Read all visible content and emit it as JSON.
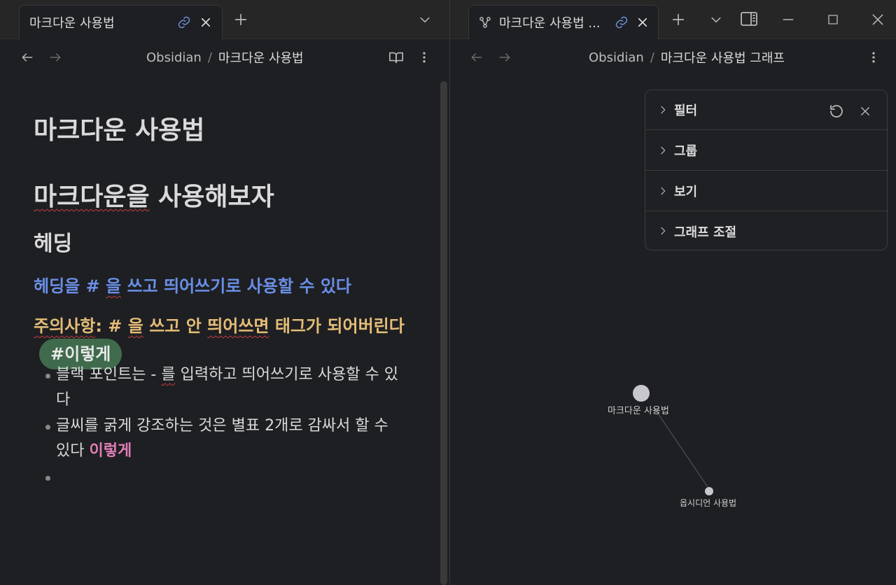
{
  "left": {
    "tab_title": "마크다운 사용법",
    "crumb_root": "Obsidian",
    "crumb_sep": "/",
    "crumb_current": "마크다운 사용법",
    "doc": {
      "h1": "마크다운 사용법",
      "h1b_underlined": "마크다운을",
      "h1b_rest": " 사용해보자",
      "h3": "헤딩",
      "h4_a": "헤딩을 # ",
      "h4_b": "을",
      "h4_c": " 쓰고 띄어쓰기로 사용할 수 있다",
      "h5_a": "주의사항",
      "h5_b": ": # ",
      "h5_c": "을",
      "h5_d": " 쓰고 안 ",
      "h5_e": "띄어쓰면",
      "h5_f": " 태그가 되어버린다",
      "tag": "#이렇게",
      "bullet1_a": "블랙 포인트는 - ",
      "bullet1_b": "를",
      "bullet1_c": " 입력하고 띄어쓰기로 사용할 수 있다",
      "bullet2_a": "글씨를 굵게 강조하는 것은 별표 2개로 감싸서 할 수 있다 ",
      "bullet2_bold": "이렇게"
    }
  },
  "right": {
    "tab_title": "마크다운 사용법 ...",
    "crumb_root": "Obsidian",
    "crumb_sep": "/",
    "crumb_current": "마크다운 사용법 그래프",
    "panel": {
      "filter": "필터",
      "group": "그룹",
      "view": "보기",
      "graph_control": "그래프 조절"
    },
    "nodes": {
      "main": "마크다운 사용법",
      "secondary": "옵시디언 사용법"
    }
  }
}
